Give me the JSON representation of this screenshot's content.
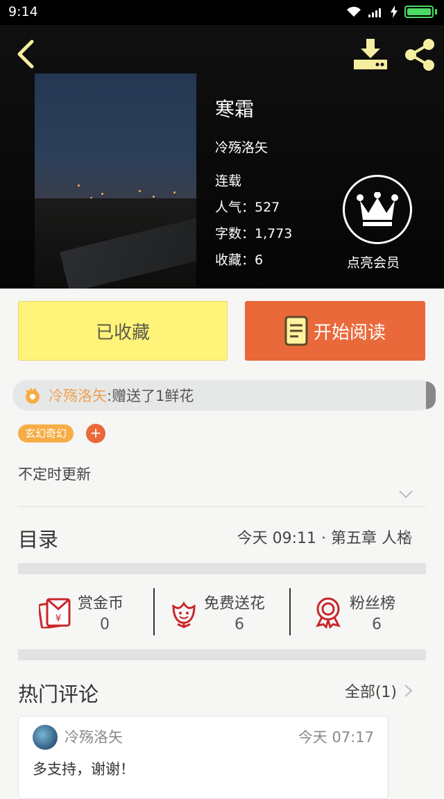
{
  "status_bar": {
    "time": "9:14"
  },
  "book": {
    "title": "寒霜",
    "author": "冷殇洛矢",
    "status": "连载",
    "popularity": "人气：527",
    "word_count": "字数：1,773",
    "favorites": "收藏：6"
  },
  "vip": {
    "label": "点亮会员"
  },
  "buttons": {
    "collected": "已收藏",
    "read": "开始阅读"
  },
  "gift": {
    "user": "冷殇洛矢",
    "message": ":赠送了1鲜花"
  },
  "tags": {
    "genre": "玄幻奇幻",
    "add": "+"
  },
  "update_note": "不定时更新",
  "toc": {
    "label": "目录",
    "latest": "今天 09:11 · 第五章  人格"
  },
  "actions": [
    {
      "label": "赏金币",
      "count": "0",
      "icon": "reward-coin-icon"
    },
    {
      "label": "免费送花",
      "count": "6",
      "icon": "flower-icon"
    },
    {
      "label": "粉丝榜",
      "count": "6",
      "icon": "fan-ranking-icon"
    }
  ],
  "comments": {
    "title": "热门评论",
    "all_label": "全部(1)",
    "items": [
      {
        "user": "冷殇洛矢",
        "time": "今天 07:17",
        "text": "多支持，谢谢！"
      }
    ]
  },
  "colors": {
    "accent_orange": "#e9693a",
    "collected_yellow": "#fff37a",
    "tag_orange": "#f6ad45",
    "icon_red": "#c8262b",
    "hero_icons": "#f5eea0"
  }
}
